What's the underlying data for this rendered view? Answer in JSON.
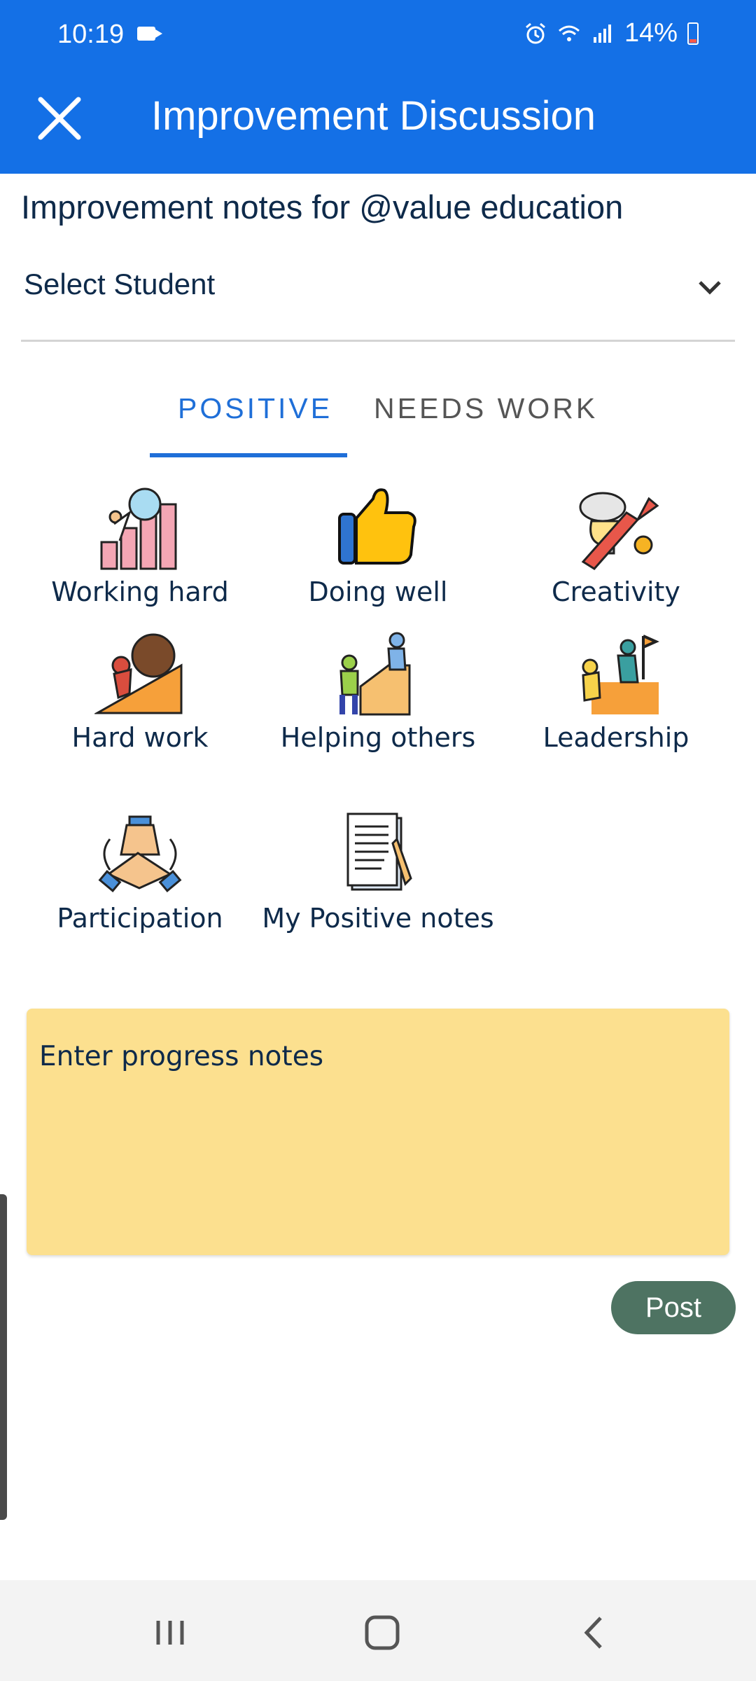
{
  "status_bar": {
    "time": "10:19",
    "battery": "14%",
    "icons": [
      "video-camera-icon",
      "alarm-icon",
      "wifi-icon",
      "signal-icon",
      "battery-icon"
    ]
  },
  "app_bar": {
    "title": "Improvement Discussion",
    "close_icon": "close-icon",
    "color": "#1470e6"
  },
  "heading": "Improvement notes for @value education",
  "student_select": {
    "placeholder": "Select Student",
    "icon": "chevron-down-icon"
  },
  "tabs": [
    {
      "label": "POSITIVE",
      "selected": true
    },
    {
      "label": "NEEDS WORK",
      "selected": false
    }
  ],
  "categories": [
    {
      "label": "Working hard",
      "icon": "working-hard-icon"
    },
    {
      "label": "Doing well",
      "icon": "thumbs-up-icon"
    },
    {
      "label": "Creativity",
      "icon": "creativity-icon"
    },
    {
      "label": "Hard work",
      "icon": "hard-work-icon"
    },
    {
      "label": "Helping others",
      "icon": "helping-others-icon"
    },
    {
      "label": "Leadership",
      "icon": "leadership-icon"
    },
    {
      "label": "Participation",
      "icon": "participation-icon"
    },
    {
      "label": "My Positive notes",
      "icon": "notes-document-icon"
    }
  ],
  "notes": {
    "placeholder": "Enter progress notes",
    "background": "#fce08f"
  },
  "post_button": {
    "label": "Post",
    "color": "#4e7362"
  },
  "nav_bar": {
    "icons": [
      "recent-apps-icon",
      "home-icon",
      "back-icon"
    ]
  }
}
